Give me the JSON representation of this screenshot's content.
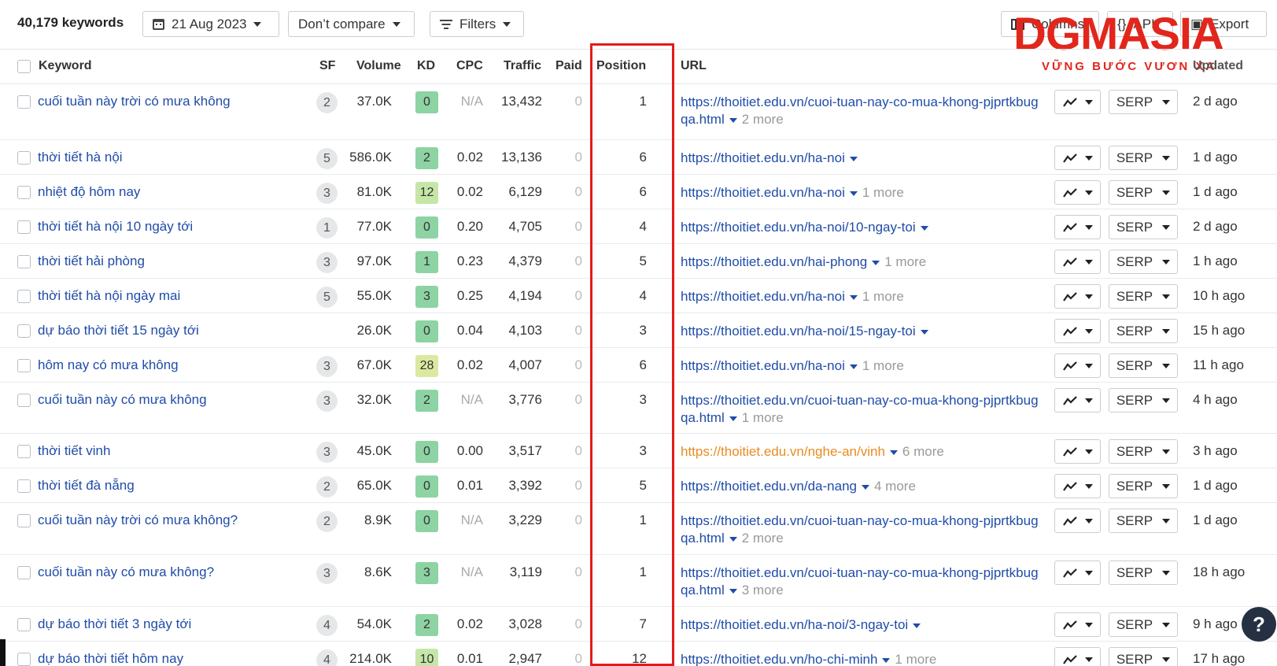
{
  "toolbar": {
    "keyword_count": "40,179 keywords",
    "date": "21 Aug 2023",
    "compare": "Don’t compare",
    "filters": "Filters",
    "columns": "Columns",
    "api": "API",
    "export": "Export"
  },
  "logo": {
    "main": "DGMASIA",
    "sub": "VỮNG BƯỚC VƯƠN XA"
  },
  "headers": {
    "keyword": "Keyword",
    "sf": "SF",
    "volume": "Volume",
    "kd": "KD",
    "cpc": "CPC",
    "traffic": "Traffic",
    "paid": "Paid",
    "position": "Position",
    "url": "URL",
    "updated": "Updated"
  },
  "kd_colors": {
    "green": "#8dd3a3",
    "lightgreen": "#c5e6a6",
    "yellowgreen": "#dbe9a0"
  },
  "rows": [
    {
      "keyword": "cuối tuần này trời có mưa không",
      "sf": "2",
      "volume": "37.0K",
      "kd": "0",
      "cpc": "N/A",
      "traffic": "13,432",
      "paid": "0",
      "position": "1",
      "url": "https://thoitiet.edu.vn/cuoi-tuan-nay-co-mua-khong-pjprtkbugqa.html",
      "more": "2 more",
      "serp": "SERP",
      "updated": "2 d ago"
    },
    {
      "keyword": "thời tiết hà nội",
      "sf": "5",
      "volume": "586.0K",
      "kd": "2",
      "cpc": "0.02",
      "traffic": "13,136",
      "paid": "0",
      "position": "6",
      "url": "https://thoitiet.edu.vn/ha-noi",
      "more": "",
      "serp": "SERP",
      "updated": "1 d ago"
    },
    {
      "keyword": "nhiệt độ hôm nay",
      "sf": "3",
      "volume": "81.0K",
      "kd": "12",
      "cpc": "0.02",
      "traffic": "6,129",
      "paid": "0",
      "position": "6",
      "url": "https://thoitiet.edu.vn/ha-noi",
      "more": "1 more",
      "serp": "SERP",
      "updated": "1 d ago"
    },
    {
      "keyword": "thời tiết hà nội 10 ngày tới",
      "sf": "1",
      "volume": "77.0K",
      "kd": "0",
      "cpc": "0.20",
      "traffic": "4,705",
      "paid": "0",
      "position": "4",
      "url": "https://thoitiet.edu.vn/ha-noi/10-ngay-toi",
      "more": "",
      "serp": "SERP",
      "updated": "2 d ago"
    },
    {
      "keyword": "thời tiết hải phòng",
      "sf": "3",
      "volume": "97.0K",
      "kd": "1",
      "cpc": "0.23",
      "traffic": "4,379",
      "paid": "0",
      "position": "5",
      "url": "https://thoitiet.edu.vn/hai-phong",
      "more": "1 more",
      "serp": "SERP",
      "updated": "1 h ago"
    },
    {
      "keyword": "thời tiết hà nội ngày mai",
      "sf": "5",
      "volume": "55.0K",
      "kd": "3",
      "cpc": "0.25",
      "traffic": "4,194",
      "paid": "0",
      "position": "4",
      "url": "https://thoitiet.edu.vn/ha-noi",
      "more": "1 more",
      "serp": "SERP",
      "updated": "10 h ago"
    },
    {
      "keyword": "dự báo thời tiết 15 ngày tới",
      "sf": "",
      "volume": "26.0K",
      "kd": "0",
      "cpc": "0.04",
      "traffic": "4,103",
      "paid": "0",
      "position": "3",
      "url": "https://thoitiet.edu.vn/ha-noi/15-ngay-toi",
      "more": "",
      "serp": "SERP",
      "updated": "15 h ago"
    },
    {
      "keyword": "hôm nay có mưa không",
      "sf": "3",
      "volume": "67.0K",
      "kd": "28",
      "cpc": "0.02",
      "traffic": "4,007",
      "paid": "0",
      "position": "6",
      "url": "https://thoitiet.edu.vn/ha-noi",
      "more": "1 more",
      "serp": "SERP",
      "updated": "11 h ago"
    },
    {
      "keyword": "cuối tuần này có mưa không",
      "sf": "3",
      "volume": "32.0K",
      "kd": "2",
      "cpc": "N/A",
      "traffic": "3,776",
      "paid": "0",
      "position": "3",
      "url": "https://thoitiet.edu.vn/cuoi-tuan-nay-co-mua-khong-pjprtkbugqa.html",
      "more": "1 more",
      "serp": "SERP",
      "updated": "4 h ago"
    },
    {
      "keyword": "thời tiết vinh",
      "sf": "3",
      "volume": "45.0K",
      "kd": "0",
      "cpc": "0.00",
      "traffic": "3,517",
      "paid": "0",
      "position": "3",
      "url": "https://thoitiet.edu.vn/nghe-an/vinh",
      "more": "6 more",
      "serp": "SERP",
      "updated": "3 h ago"
    },
    {
      "keyword": "thời tiết đà nẵng",
      "sf": "2",
      "volume": "65.0K",
      "kd": "0",
      "cpc": "0.01",
      "traffic": "3,392",
      "paid": "0",
      "position": "5",
      "url": "https://thoitiet.edu.vn/da-nang",
      "more": "4 more",
      "serp": "SERP",
      "updated": "1 d ago"
    },
    {
      "keyword": "cuối tuần này trời có mưa không?",
      "sf": "2",
      "volume": "8.9K",
      "kd": "0",
      "cpc": "N/A",
      "traffic": "3,229",
      "paid": "0",
      "position": "1",
      "url": "https://thoitiet.edu.vn/cuoi-tuan-nay-co-mua-khong-pjprtkbugqa.html",
      "more": "2 more",
      "serp": "SERP",
      "updated": "1 d ago"
    },
    {
      "keyword": "cuối tuần này có mưa không?",
      "sf": "3",
      "volume": "8.6K",
      "kd": "3",
      "cpc": "N/A",
      "traffic": "3,119",
      "paid": "0",
      "position": "1",
      "url": "https://thoitiet.edu.vn/cuoi-tuan-nay-co-mua-khong-pjprtkbugqa.html",
      "more": "3 more",
      "serp": "SERP",
      "updated": "18 h ago"
    },
    {
      "keyword": "dự báo thời tiết 3 ngày tới",
      "sf": "4",
      "volume": "54.0K",
      "kd": "2",
      "cpc": "0.02",
      "traffic": "3,028",
      "paid": "0",
      "position": "7",
      "url": "https://thoitiet.edu.vn/ha-noi/3-ngay-toi",
      "more": "",
      "serp": "SERP",
      "updated": "9 h ago"
    },
    {
      "keyword": "dự báo thời tiết hôm nay",
      "sf": "4",
      "volume": "214.0K",
      "kd": "10",
      "cpc": "0.01",
      "traffic": "2,947",
      "paid": "0",
      "position": "12",
      "url": "https://thoitiet.edu.vn/ho-chi-minh",
      "more": "1 more",
      "serp": "SERP",
      "updated": "17 h ago"
    }
  ],
  "help": "?"
}
